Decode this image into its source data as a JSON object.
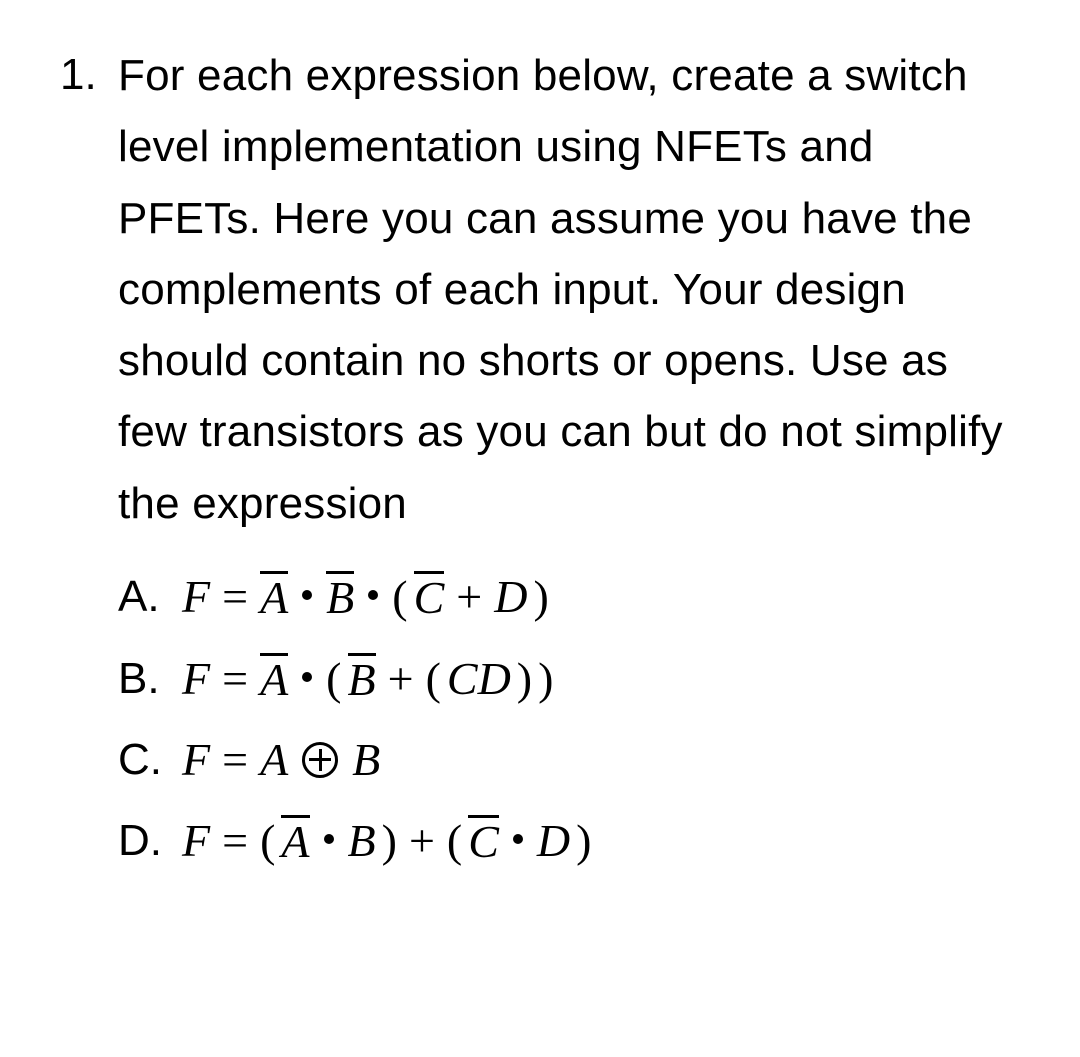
{
  "problem": {
    "number": "1.",
    "prompt": "For each expression below, create a switch level implementation using NFETs and PFETs. Here you can assume you have the complements of each input. Your design should contain no shorts or opens. Use as few transistors as you can but do not simplify the expression",
    "vars": {
      "F": "F",
      "A": "A",
      "B": "B",
      "C": "C",
      "D": "D",
      "CD": "CD"
    },
    "sym": {
      "eq": "=",
      "plus": "+",
      "lp": "(",
      "rp": ")"
    },
    "options": [
      {
        "letter": "A."
      },
      {
        "letter": "B."
      },
      {
        "letter": "C."
      },
      {
        "letter": "D."
      }
    ]
  }
}
